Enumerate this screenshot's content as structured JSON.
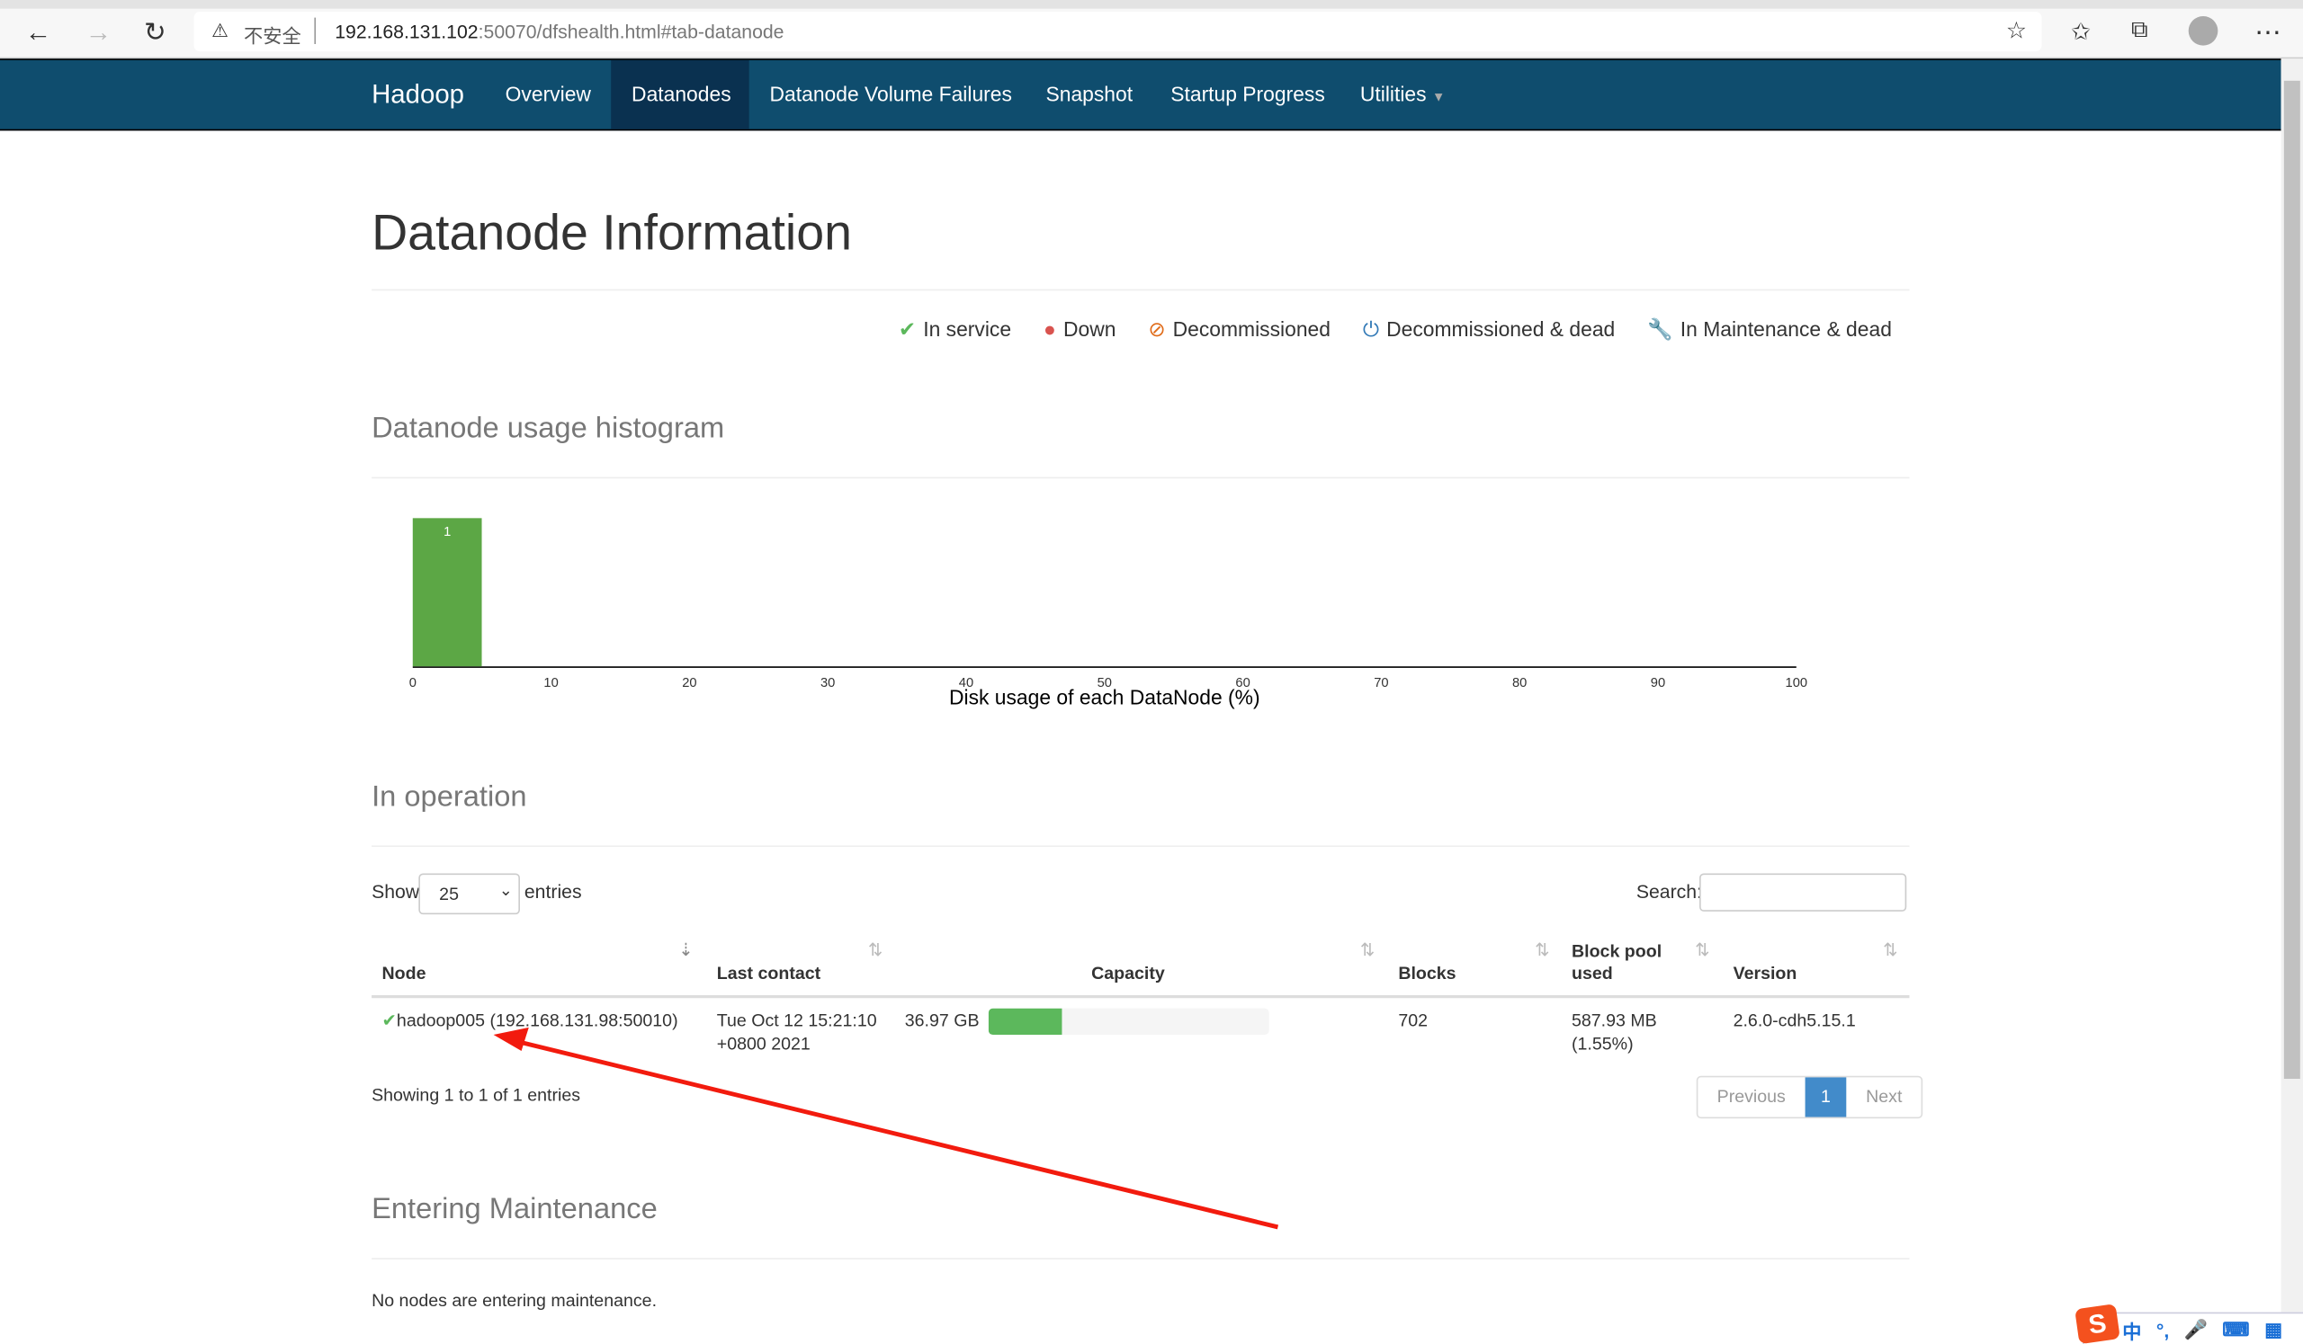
{
  "browser": {
    "security_label": "不安全",
    "url_host": "192.168.131.102",
    "url_rest": ":50070/dfshealth.html#tab-datanode"
  },
  "nav": {
    "brand": "Hadoop",
    "items": [
      "Overview",
      "Datanodes",
      "Datanode Volume Failures",
      "Snapshot",
      "Startup Progress",
      "Utilities"
    ],
    "active": "Datanodes"
  },
  "page": {
    "title": "Datanode Information"
  },
  "legend": [
    {
      "icon": "check-icon",
      "label": "In service",
      "color": "#5cb85c"
    },
    {
      "icon": "exclamation-circle-icon",
      "label": "Down",
      "color": "#d9534f"
    },
    {
      "icon": "ban-icon",
      "label": "Decommissioned",
      "color": "#e06c1a"
    },
    {
      "icon": "power-icon",
      "label": "Decommissioned & dead",
      "color": "#337ab7"
    },
    {
      "icon": "wrench-icon",
      "label": "In Maintenance & dead",
      "color": "#f0ad4e"
    }
  ],
  "histogram": {
    "heading": "Datanode usage histogram"
  },
  "chart_data": {
    "type": "bar",
    "xlabel": "Disk usage of each DataNode (%)",
    "xlim": [
      0,
      100
    ],
    "xticks": [
      "0",
      "10",
      "20",
      "30",
      "40",
      "50",
      "60",
      "70",
      "80",
      "90",
      "100"
    ],
    "bins": [
      {
        "range": [
          0,
          5
        ],
        "count": 1
      }
    ],
    "data_labels": [
      "1"
    ],
    "color": "#5ca745"
  },
  "operation": {
    "heading": "In operation",
    "show_label": "Show",
    "entries_label": "entries",
    "page_size": "25",
    "search_label": "Search:",
    "search_value": "",
    "columns": [
      "Node",
      "Last contact",
      "Capacity",
      "Blocks",
      "Block pool used",
      "Version"
    ],
    "rows": [
      {
        "status": "in-service",
        "node": "hadoop005 (192.168.131.98:50010)",
        "last_contact_1": "Tue Oct 12 15:21:10",
        "last_contact_2": "+0800 2021",
        "capacity": "36.97 GB",
        "capacity_used_pct": 26,
        "blocks": "702",
        "pool_used_1": "587.93 MB",
        "pool_used_2": "(1.55%)",
        "version": "2.6.0-cdh5.15.1"
      }
    ],
    "info": "Showing 1 to 1 of 1 entries",
    "pagination": {
      "previous": "Previous",
      "current": "1",
      "next": "Next"
    }
  },
  "maintenance": {
    "heading": "Entering Maintenance",
    "empty": "No nodes are entering maintenance."
  },
  "ime": {
    "mode": "中",
    "punct": "°,"
  }
}
